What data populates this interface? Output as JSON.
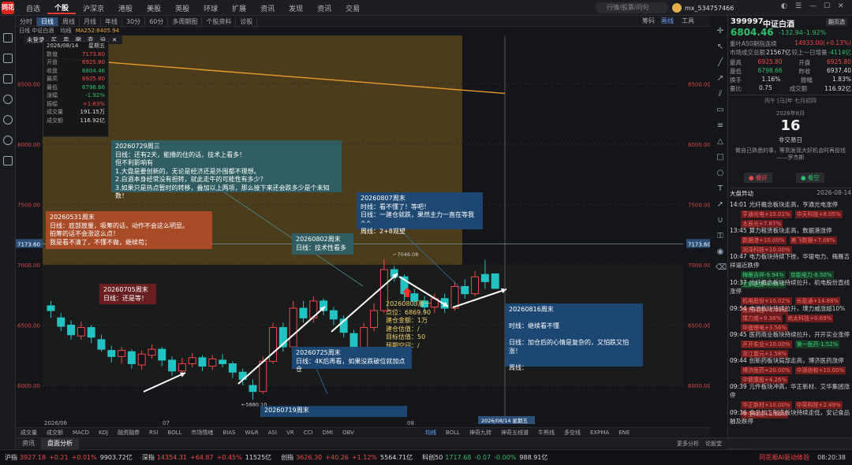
{
  "topbar": {
    "logo": "同花",
    "nav": [
      "自选",
      "个股",
      "沪深京",
      "港股",
      "美股",
      "英股",
      "环球",
      "扩展",
      "资讯",
      "发现",
      "资讯",
      "交易"
    ],
    "nav_active_index": 1,
    "search_placeholder": "行情/股票/问句",
    "user": "mx_534757466"
  },
  "toolbar2": {
    "tabs": [
      "分时",
      "日线",
      "周线",
      "月线",
      "年线",
      "30分",
      "60分",
      "多周期图",
      "个股资料",
      "诊股"
    ],
    "active_index": 1,
    "right_items": [
      "筹码",
      "画线",
      "工具"
    ]
  },
  "chart_head": {
    "label": "日线  中证白酒",
    "ma_label": "均线",
    "ma_value": "MA252:8405.94"
  },
  "orderbar": [
    "未登录",
    "买",
    "卖",
    "撤",
    "查",
    "设",
    "✕"
  ],
  "datawin": {
    "date": "2026/08/14",
    "weekday": "星期五",
    "rows": [
      {
        "k": "数值",
        "v": "7173.60",
        "c": "up"
      },
      {
        "k": "开盘",
        "v": "6925.80",
        "c": "up"
      },
      {
        "k": "收盘",
        "v": "6804.46",
        "c": "dn"
      },
      {
        "k": "最高",
        "v": "6925.80",
        "c": "up"
      },
      {
        "k": "最低",
        "v": "6798.66",
        "c": "dn"
      },
      {
        "k": "涨幅",
        "v": "-1.92%",
        "c": "dn"
      },
      {
        "k": "振幅",
        "v": "+1.83%",
        "c": "up"
      },
      {
        "k": "成交量",
        "v": "191.15万",
        "c": "wh"
      },
      {
        "k": "成交额",
        "v": "116.92亿",
        "c": "wh"
      }
    ]
  },
  "axis_labels": [
    "8500.00",
    "8000.00",
    "7500.00",
    "7000.00",
    "6500.00",
    "6000.00"
  ],
  "price_tag": "7173.60",
  "x_labels": [
    "2026/06",
    "07",
    "08"
  ],
  "cursor_date": "2026/08/14 星期五",
  "chart_marks": {
    "high": "7046.08",
    "low": "5880.10"
  },
  "notes": {
    "n0729": "20260729周三\n日线：还有2天，能撸的住的话，技术上看多！\n但不利影响有\n1.大盘是要创新的，无论是经济还是外围都不理想。\n2.白酒本身经常没有担转，就此走牛的可能性有多少？\n3.如果只是热点暂时的转移，叠加以上两项，那么接下来还会跌多少是个未知数！",
    "n0531": "20260531周末\n日线：底部放量，吸筹的话，动作不会这么明显。\n拍筹的话不会涨这么点！\n我是看不清了，不懂不做，继续苟；",
    "n0802": "20260802周末\n日线：技术性看多",
    "n0807": "20260807周末\n时线：看不懂了！等吧！\n日线：一建仓就跌，果然主力一直在等我^^\n周线：2+8观望",
    "n0705": "20260705周末\n日线：还是等！",
    "n0803": "20260803周一\n点位：6869.90\n建仓金额：1万\n建仓估值：/\n目标估值：50\n预期空间：/",
    "n0725": "20260725周末\n日线：4K后再看，如果没跌破位就加点仓",
    "n0719": "20260719周末",
    "n0816": "20260816周末\n\n时线：继续看不懂\n\n日线：加仓后的心情是复杂的，又怕跌又怕涨！\n\n周线："
  },
  "indicators_left": [
    "成交量",
    "成交额",
    "MACD",
    "KDJ",
    "融资融券",
    "RSI",
    "BOLL",
    "市场情绪",
    "BIAS",
    "W&R",
    "ASI",
    "VR",
    "CCI",
    "DMI",
    "OBV"
  ],
  "indicators_right": [
    "均线",
    "BOLL",
    "神奇九转",
    "神奇五线谱",
    "牛熊线",
    "多空线",
    "EXPMA",
    "ENE"
  ],
  "bottom_tabs": [
    "资讯",
    "盘面分析"
  ],
  "bottom_right": [
    "更多分析",
    "论股堂"
  ],
  "rpanel": {
    "code": "399997",
    "name": "中证白酒",
    "switch": "翻页选",
    "price": "6804.46",
    "change": "-132.94",
    "pct": "-1.92%",
    "line1_k": "重叶A50期指连续",
    "line1_v": "14933.00(+0.13%)",
    "line2_k": "市场成交总额",
    "line2_v": "21567亿",
    "line2_k2": "较上一日增量",
    "line2_v2": "-4114亿",
    "quotes": [
      {
        "k1": "最高",
        "v1": "6925.80",
        "k2": "开盘",
        "v2": "6925.80"
      },
      {
        "k1": "最低",
        "v1": "6798.66",
        "k2": "昨收",
        "v2": "6937.40"
      },
      {
        "k1": "换手",
        "v1": "1.16%",
        "k2": "振幅",
        "v2": "1.83%"
      },
      {
        "k1": "量比",
        "v1": "0.75",
        "k2": "成交额",
        "v2": "116.92亿"
      }
    ],
    "cal_head": "丙午 [马]年 七月初四",
    "cal_month": "2026年8月",
    "cal_day": "16",
    "cal_note": "非交易日",
    "quote_text": "做自己熟悉的事，等到发现大好机会时再投钱\n——罗杰斯",
    "btn_up": "● 看好",
    "btn_down": "● 看空",
    "news_head": "大盘异动",
    "news_date": "2026-08-14",
    "news": [
      {
        "time": "14:01",
        "text": "光纤概念板块走高，亨通光电涨停",
        "tags": [
          {
            "t": "亨通光电+10.01%",
            "c": "red"
          },
          {
            "t": "中天科技+8.05%",
            "c": "red"
          },
          {
            "t": "太辰光+7.87%",
            "c": "red"
          }
        ]
      },
      {
        "time": "13:45",
        "text": "算力租赁板块走高，数据港涨停",
        "tags": [
          {
            "t": "数据港+10.00%",
            "c": "red"
          },
          {
            "t": "美飞数据+7.08%",
            "c": "red"
          },
          {
            "t": "润泽科技+10.00%",
            "c": "red"
          }
        ]
      },
      {
        "time": "10:47",
        "text": "电力板块持续下挫，华银电力、梅雁吉祥逼近跌停",
        "tags": [
          {
            "t": "梅雁吉祥-9.94%",
            "c": "grn"
          },
          {
            "t": "京能电力-8.50%",
            "c": "grn"
          },
          {
            "t": "立新能源-9.95%",
            "c": "grn"
          }
        ]
      },
      {
        "time": "10:37",
        "text": "光纤概念板块持续拉升，机电股份直线涨停",
        "tags": [
          {
            "t": "机电股份+10.02%",
            "c": "red"
          },
          {
            "t": "长盈通+14.88%",
            "c": "red"
          },
          {
            "t": "致尚科技+4.44%",
            "c": "red"
          }
        ]
      },
      {
        "time": "09:54",
        "text": "电池板块持续拉升，璞力威涨超10%",
        "tags": [
          {
            "t": "璞力威+9.38%",
            "c": "red"
          },
          {
            "t": "尚太科技+0.69%",
            "c": "red"
          },
          {
            "t": "华盛锂电+3.56%",
            "c": "red"
          }
        ]
      },
      {
        "time": "09:45",
        "text": "医药商业板块持续拉升，开开实业涨停",
        "tags": [
          {
            "t": "开开实业+10.00%",
            "c": "red"
          },
          {
            "t": "第一医药-1.52%",
            "c": "grn"
          },
          {
            "t": "浙江震元+1.58%",
            "c": "red"
          }
        ]
      },
      {
        "time": "09:44",
        "text": "创新药板块局部走高，博济医药涨停",
        "tags": [
          {
            "t": "博济医药+20.00%",
            "c": "red"
          },
          {
            "t": "中源协和+10.00%",
            "c": "red"
          },
          {
            "t": "中健康股+4.26%",
            "c": "red"
          }
        ]
      },
      {
        "time": "09:39",
        "text": "元件板块冲高，华正新材、艾华集团涨停",
        "tags": [
          {
            "t": "华正新材+10.00%",
            "c": "red"
          },
          {
            "t": "中英科技+2.49%",
            "c": "red"
          },
          {
            "t": "中坚科技+8.90%",
            "c": "red"
          }
        ]
      },
      {
        "time": "09:36",
        "text": "食品加工制造板块持续走低，安记食品触及跌停",
        "tags": []
      }
    ],
    "bottom_tabs": [
      "异动",
      "盘口"
    ]
  },
  "ticker": [
    {
      "name": "沪指",
      "price": "3927.18",
      "chg": "+0.21",
      "pct": "+0.01%",
      "amt": "9903.72亿",
      "c": "up"
    },
    {
      "name": "深指",
      "price": "14354.31",
      "chg": "+64.87",
      "pct": "+0.45%",
      "amt": "11525亿",
      "c": "up"
    },
    {
      "name": "创指",
      "price": "3626.30",
      "chg": "+40.26",
      "pct": "+1.12%",
      "amt": "5564.71亿",
      "c": "up"
    },
    {
      "name": "科创50",
      "price": "1717.68",
      "chg": "-0.07",
      "pct": "-0.00%",
      "amt": "988.91亿",
      "c": "dn"
    }
  ],
  "ticker_right": "同花顺AI驱动体验",
  "clock": "08:20:38",
  "chart_data": {
    "type": "candlestick",
    "ylim": [
      5700,
      8900
    ],
    "ma_line": {
      "from": 8720,
      "to": 8420
    },
    "candles": [
      [
        6660,
        6620,
        6700,
        6560
      ],
      [
        6560,
        6490,
        6600,
        6450
      ],
      [
        6500,
        6420,
        6540,
        6380
      ],
      [
        6410,
        6480,
        6530,
        6380
      ],
      [
        6480,
        6400,
        6500,
        6350
      ],
      [
        6380,
        6300,
        6420,
        6280
      ],
      [
        6290,
        6240,
        6330,
        6190
      ],
      [
        6240,
        6290,
        6320,
        6180
      ],
      [
        6280,
        6180,
        6300,
        6140
      ],
      [
        6170,
        6260,
        6290,
        6130
      ],
      [
        6250,
        6300,
        6340,
        6220
      ],
      [
        6300,
        6210,
        6320,
        6160
      ],
      [
        6210,
        6120,
        6240,
        6080
      ],
      [
        6120,
        6180,
        6230,
        6090
      ],
      [
        6180,
        6230,
        6270,
        6150
      ],
      [
        6230,
        6160,
        6250,
        6120
      ],
      [
        6160,
        6220,
        6250,
        6130
      ],
      [
        6210,
        6180,
        6260,
        6150
      ],
      [
        6180,
        6110,
        6200,
        6060
      ],
      [
        6110,
        6050,
        6140,
        6000
      ],
      [
        6000,
        5950,
        6050,
        5880
      ],
      [
        5950,
        6200,
        6240,
        5930
      ],
      [
        6200,
        6480,
        6520,
        6180
      ],
      [
        6480,
        6320,
        6520,
        6280
      ],
      [
        6320,
        6640,
        6700,
        6300
      ],
      [
        6640,
        6560,
        6700,
        6520
      ],
      [
        6560,
        6700,
        6740,
        6520
      ],
      [
        6700,
        6620,
        6720,
        6580
      ],
      [
        6620,
        6550,
        6650,
        6500
      ],
      [
        6550,
        6440,
        6580,
        6400
      ],
      [
        6430,
        6300,
        6460,
        6260
      ],
      [
        6300,
        6480,
        6520,
        6280
      ],
      [
        6480,
        6620,
        6680,
        6450
      ],
      [
        6620,
        6960,
        7046,
        6600
      ],
      [
        6960,
        6900,
        6990,
        6860
      ],
      [
        6900,
        6760,
        6920,
        6700
      ],
      [
        6760,
        6700,
        6800,
        6660
      ],
      [
        6700,
        6650,
        6740,
        6610
      ],
      [
        6650,
        6720,
        6760,
        6600
      ],
      [
        6720,
        6640,
        6760,
        6600
      ],
      [
        6640,
        6820,
        6860,
        6620
      ],
      [
        6820,
        6760,
        6880,
        6720
      ],
      [
        6760,
        6900,
        6950,
        6740
      ],
      [
        6920,
        6860,
        7040,
        6800
      ],
      [
        6925,
        6804,
        6926,
        6799
      ]
    ]
  }
}
